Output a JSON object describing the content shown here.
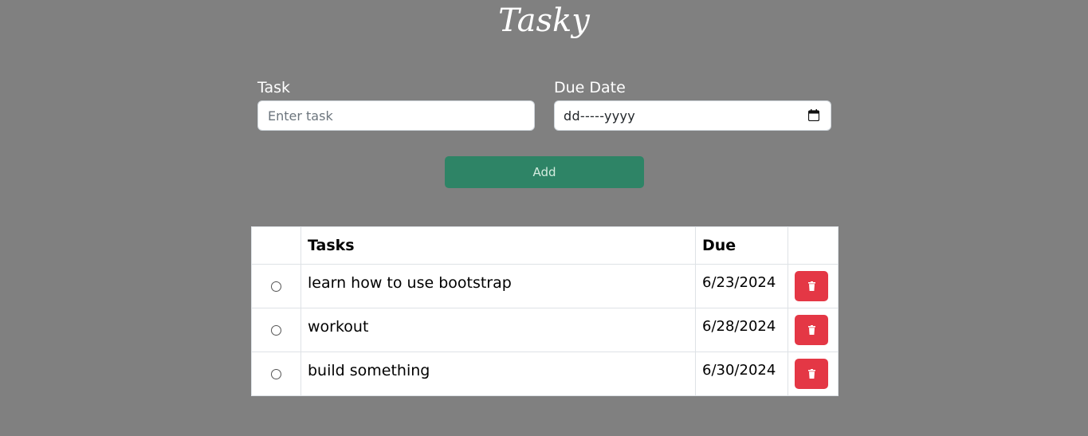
{
  "app": {
    "title": "Tasky"
  },
  "form": {
    "task_label": "Task",
    "task_placeholder": "Enter task",
    "task_value": "",
    "due_label": "Due Date",
    "due_placeholder": "dd-----yyyy",
    "due_value": "",
    "add_label": "Add"
  },
  "table": {
    "headers": [
      "",
      "Tasks",
      "Due",
      ""
    ],
    "rows": [
      {
        "task": "learn how to use bootstrap",
        "due": "6/23/2024"
      },
      {
        "task": "workout",
        "due": "6/28/2024"
      },
      {
        "task": "build something",
        "due": "6/30/2024"
      }
    ]
  },
  "colors": {
    "background": "#808080",
    "add_button": "#2e8466",
    "delete_button": "#e43745"
  },
  "icons": {
    "date": "calendar-icon",
    "delete": "trash-icon"
  }
}
